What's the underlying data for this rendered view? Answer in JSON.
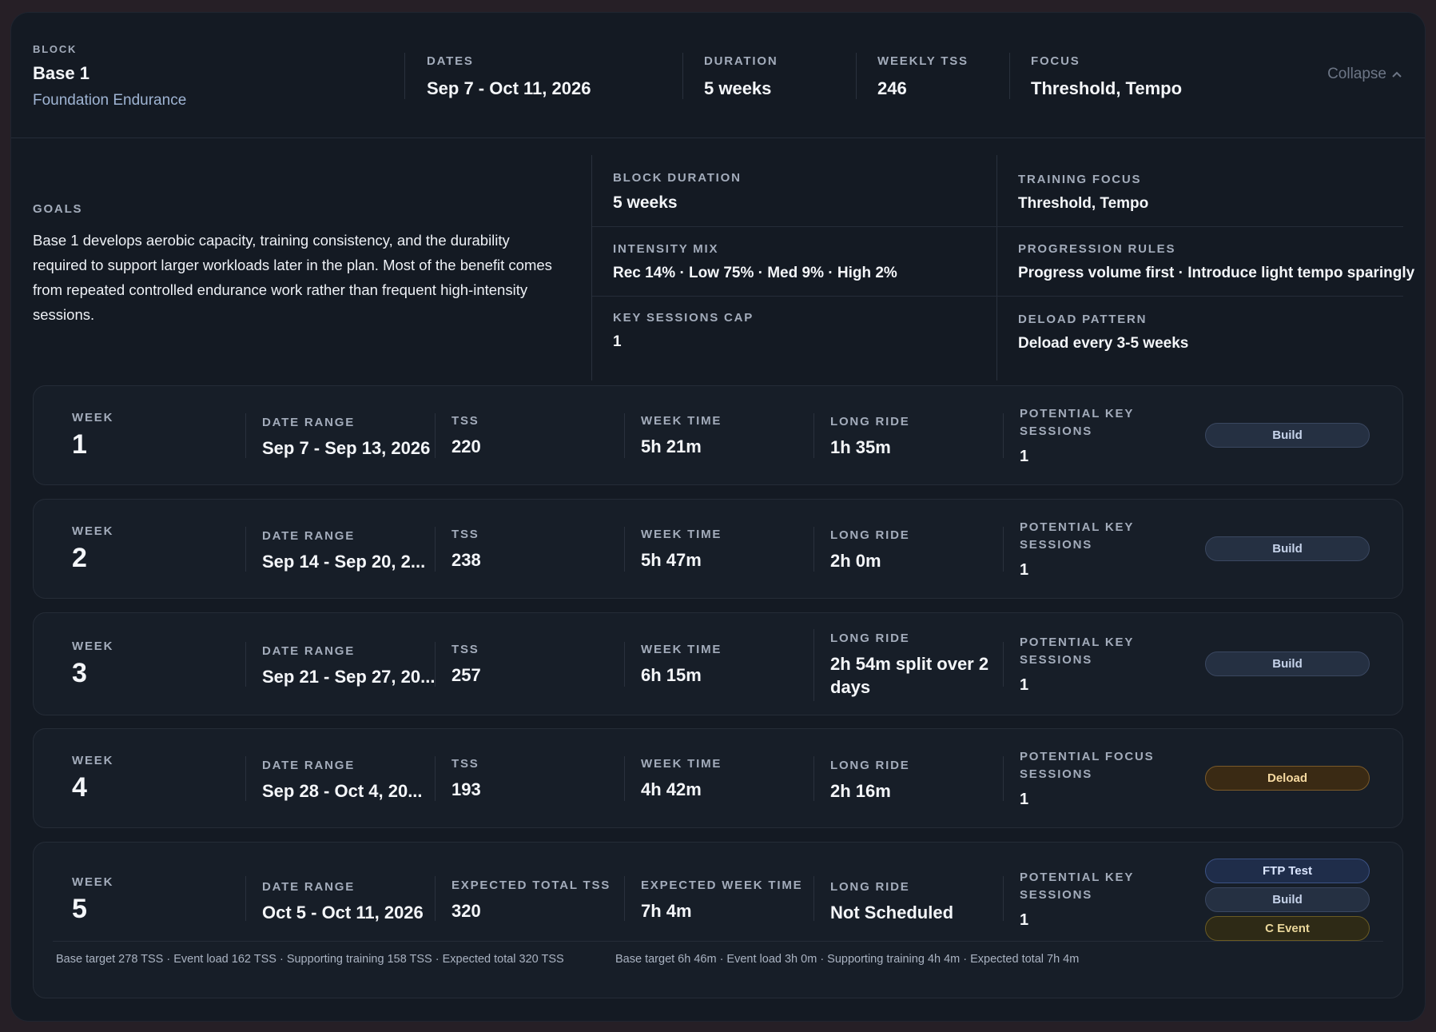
{
  "block": {
    "label": "BLOCK",
    "name": "Base 1",
    "subtitle": "Foundation Endurance",
    "dates_label": "DATES",
    "dates": "Sep 7 - Oct 11, 2026",
    "duration_label": "DURATION",
    "duration": "5 weeks",
    "weekly_tss_label": "WEEKLY TSS",
    "weekly_tss": "246",
    "focus_label": "FOCUS",
    "focus": "Threshold, Tempo",
    "collapse_label": "Collapse"
  },
  "overview": {
    "goals_label": "GOALS",
    "goals_text": "Base 1 develops aerobic capacity, training consistency, and the durability required to support larger workloads later in the plan. Most of the benefit comes from repeated controlled endurance work rather than frequent high-intensity sessions.",
    "block_duration_label": "BLOCK DURATION",
    "block_duration": "5 weeks",
    "training_focus_label": "TRAINING FOCUS",
    "training_focus": "Threshold, Tempo",
    "intensity_mix_label": "INTENSITY MIX",
    "intensity_mix": "Rec 14% · Low 75% · Med 9% · High 2%",
    "progression_rules_label": "PROGRESSION RULES",
    "progression_rules": "Progress volume first · Introduce light tempo sparingly",
    "key_sessions_cap_label": "KEY SESSIONS CAP",
    "key_sessions_cap": "1",
    "deload_pattern_label": "DELOAD PATTERN",
    "deload_pattern": "Deload every 3-5 weeks"
  },
  "weeks": [
    {
      "week_label": "WEEK",
      "number": "1",
      "date_range_label": "DATE RANGE",
      "date_range": "Sep 7 - Sep 13, 2026",
      "tss_label": "TSS",
      "tss": "220",
      "time_label": "WEEK TIME",
      "time": "5h 21m",
      "long_ride_label": "LONG RIDE",
      "long_ride": "1h 35m",
      "sessions_label_1": "POTENTIAL KEY",
      "sessions_label_2": "SESSIONS",
      "sessions": "1",
      "badges": [
        "Build"
      ]
    },
    {
      "week_label": "WEEK",
      "number": "2",
      "date_range_label": "DATE RANGE",
      "date_range": "Sep 14 - Sep 20, 2...",
      "tss_label": "TSS",
      "tss": "238",
      "time_label": "WEEK TIME",
      "time": "5h 47m",
      "long_ride_label": "LONG RIDE",
      "long_ride": "2h 0m",
      "sessions_label_1": "POTENTIAL KEY",
      "sessions_label_2": "SESSIONS",
      "sessions": "1",
      "badges": [
        "Build"
      ]
    },
    {
      "week_label": "WEEK",
      "number": "3",
      "date_range_label": "DATE RANGE",
      "date_range": "Sep 21 - Sep 27, 20...",
      "tss_label": "TSS",
      "tss": "257",
      "time_label": "WEEK TIME",
      "time": "6h 15m",
      "long_ride_label": "LONG RIDE",
      "long_ride_1": "2h 54m split over 2",
      "long_ride_2": "days",
      "sessions_label_1": "POTENTIAL KEY",
      "sessions_label_2": "SESSIONS",
      "sessions": "1",
      "badges": [
        "Build"
      ]
    },
    {
      "week_label": "WEEK",
      "number": "4",
      "date_range_label": "DATE RANGE",
      "date_range": "Sep 28 - Oct 4, 20...",
      "tss_label": "TSS",
      "tss": "193",
      "time_label": "WEEK TIME",
      "time": "4h 42m",
      "long_ride_label": "LONG RIDE",
      "long_ride": "2h 16m",
      "sessions_label_1": "POTENTIAL FOCUS",
      "sessions_label_2": "SESSIONS",
      "sessions": "1",
      "badges": [
        "Deload"
      ]
    },
    {
      "week_label": "WEEK",
      "number": "5",
      "date_range_label": "DATE RANGE",
      "date_range": "Oct 5 - Oct 11, 2026",
      "tss_label": "EXPECTED TOTAL TSS",
      "tss": "320",
      "time_label": "EXPECTED WEEK TIME",
      "time": "7h 4m",
      "long_ride_label": "LONG RIDE",
      "long_ride": "Not Scheduled",
      "sessions_label_1": "POTENTIAL KEY",
      "sessions_label_2": "SESSIONS",
      "sessions": "1",
      "badges": [
        "FTP Test",
        "Build",
        "C Event"
      ],
      "footnote_tss": "Base target 278 TSS · Event load 162 TSS · Supporting training 158 TSS · Expected total 320 TSS",
      "footnote_time": "Base target 6h 46m · Event load 3h 0m · Supporting training 4h 4m · Expected total 7h 4m"
    }
  ]
}
